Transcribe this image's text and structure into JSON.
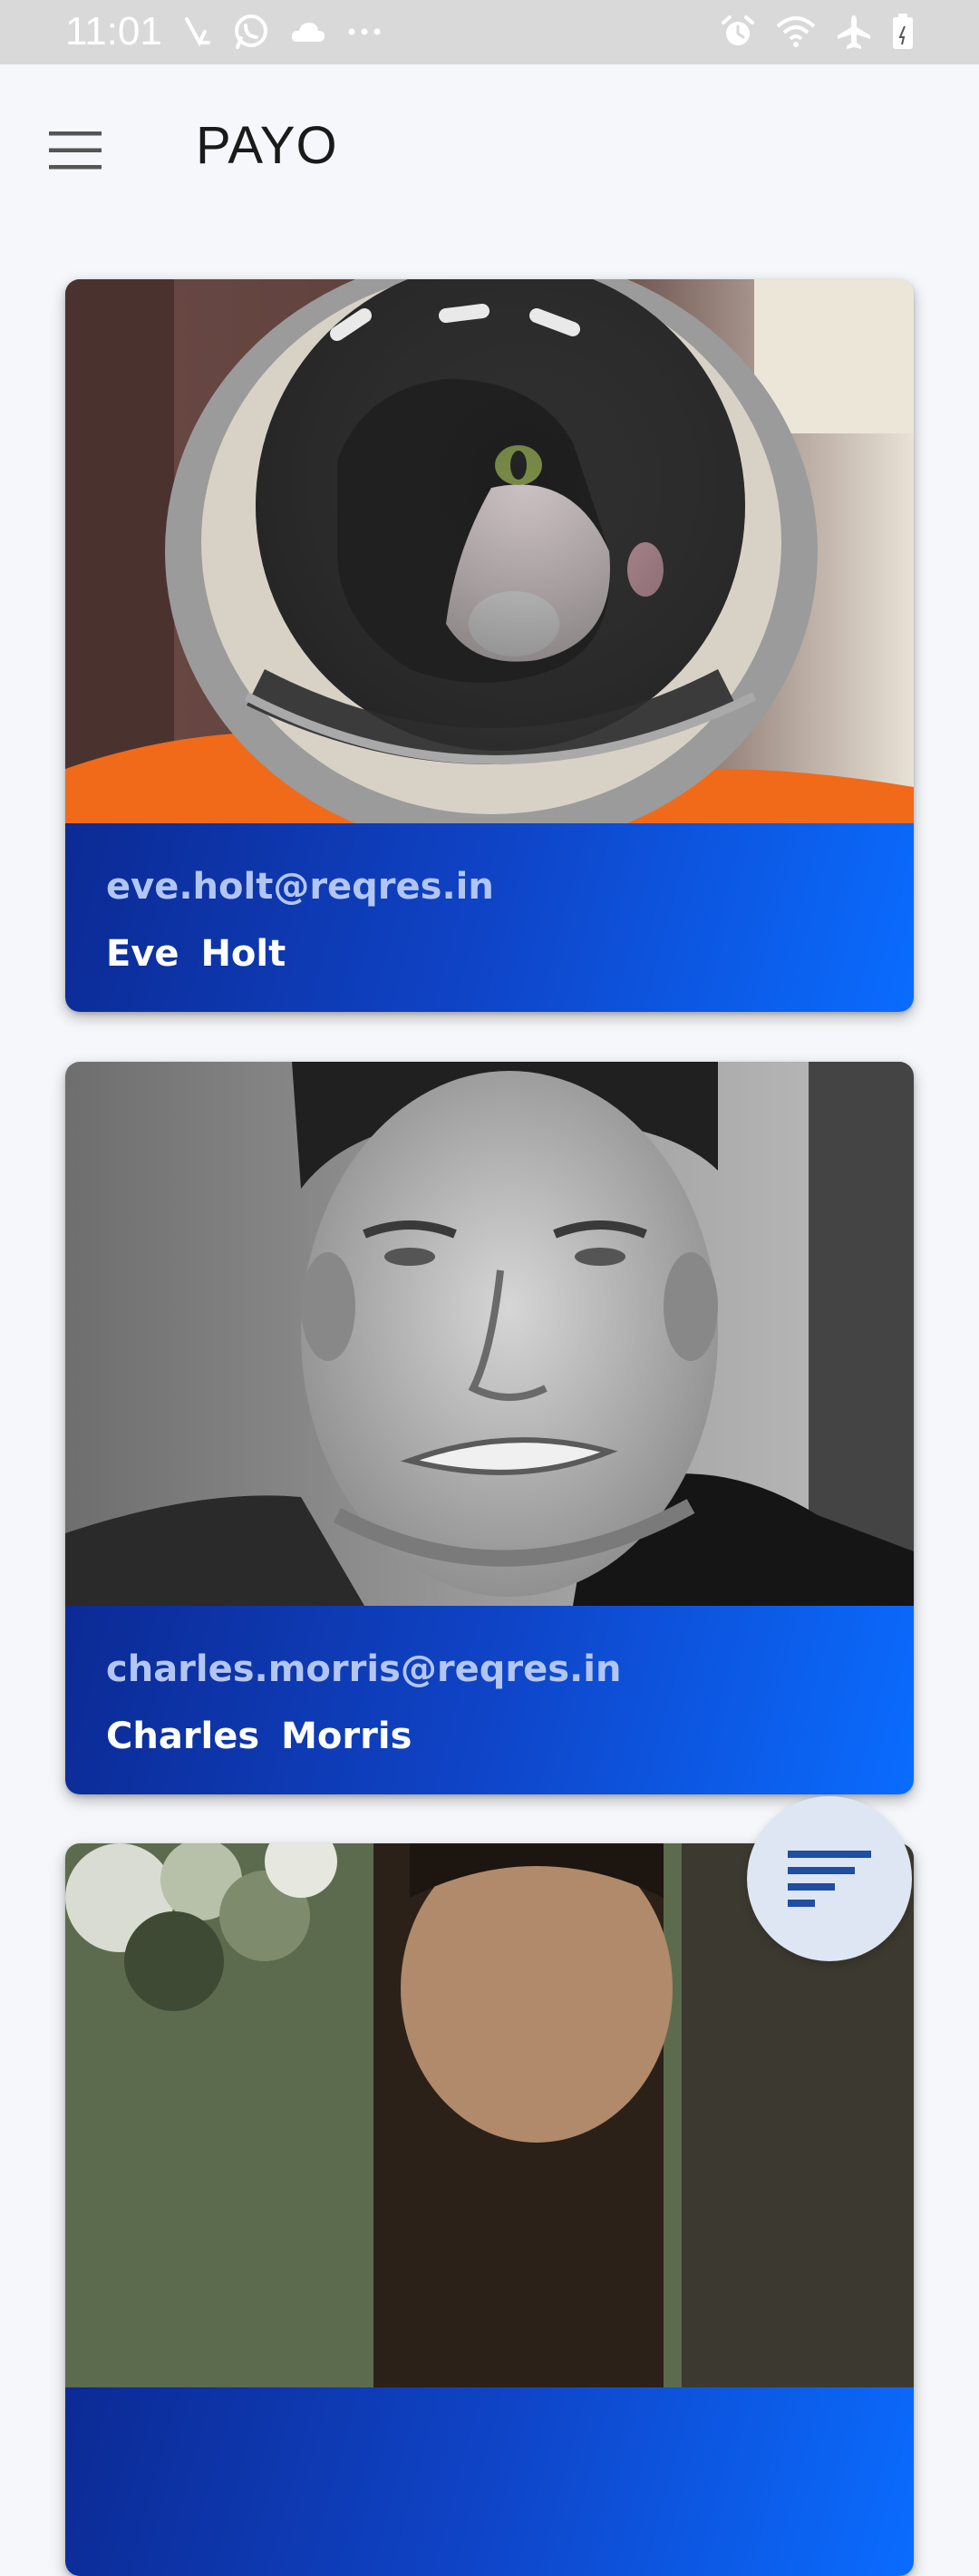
{
  "status_bar": {
    "time": "11:01",
    "left_icons": [
      "missed-call-icon",
      "whatsapp-icon",
      "cloud-icon",
      "more-dots-icon"
    ],
    "right_icons": [
      "alarm-icon",
      "wifi-icon",
      "airplane-icon",
      "battery-icon"
    ]
  },
  "app_bar": {
    "title": "PAYO",
    "menu_icon": "hamburger-menu-icon"
  },
  "users": [
    {
      "email": "eve.holt@reqres.in",
      "name": "Eve  Holt",
      "photo": "astronaut-cat"
    },
    {
      "email": "charles.morris@reqres.in",
      "name": "Charles  Morris",
      "photo": "man-portrait-bw"
    },
    {
      "email": "",
      "name": "",
      "photo": "man-portrait-outdoor"
    }
  ],
  "fab": {
    "icon": "filter-sort-icon"
  },
  "colors": {
    "card_gradient_start": "#0c2a94",
    "card_gradient_end": "#0a6cff",
    "email_text": "#b3c6f2",
    "name_text": "#ffffff",
    "fab_background": "#dde6f2",
    "fab_icon": "#1f4ea3",
    "status_bar": "#d9d9d9",
    "page_background": "#f5f7fa"
  }
}
